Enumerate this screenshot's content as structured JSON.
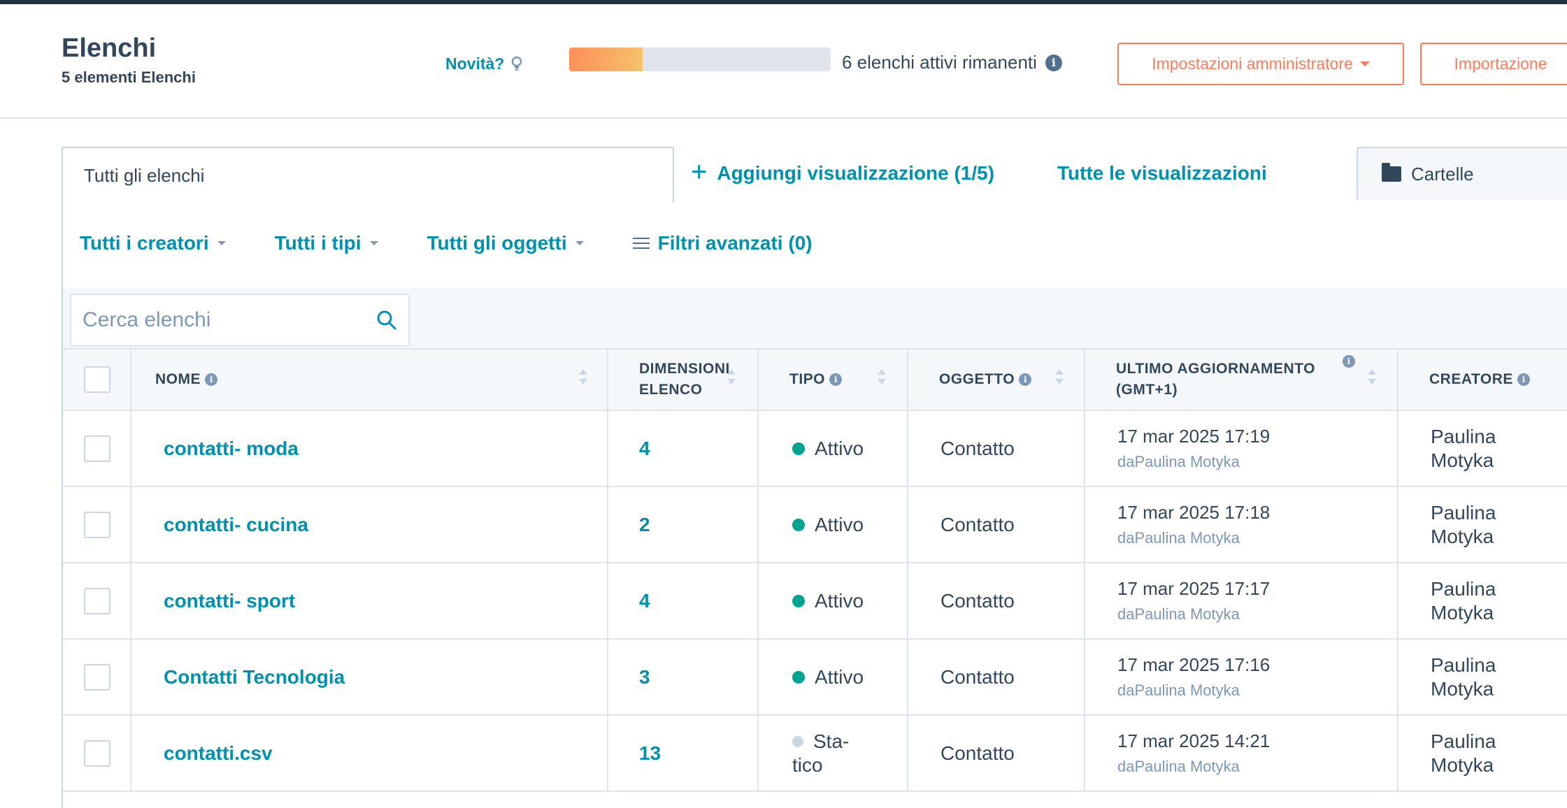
{
  "header": {
    "title": "Elenchi",
    "subtitle": "5 elementi Elenchi",
    "news_label": "Novità?",
    "usage_fraction": 0.28,
    "remaining_text": "6 elenchi attivi rimanenti",
    "admin_button": "Impostazioni amministratore",
    "import_button": "Importazione"
  },
  "tabs": {
    "active": "Tutti gli elenchi",
    "add_view": "Aggiungi visualizzazione (1/5)",
    "all_views": "Tutte le visualizzazioni",
    "folders": "Cartelle"
  },
  "filters": {
    "creators": "Tutti i creatori",
    "types": "Tutti i tipi",
    "objects": "Tutti gli oggetti",
    "advanced": "Filtri avanzati (0)"
  },
  "search": {
    "placeholder": "Cerca elenchi"
  },
  "columns": {
    "name": "NOME",
    "size": "DIMENSIONI ELENCO",
    "type": "TIPO",
    "object": "OGGETTO",
    "updated": "ULTIMO AGGIORNAMENTO (GMT+1)",
    "creator": "CREATORE"
  },
  "rows": [
    {
      "name": "contatti- moda",
      "size": "4",
      "type": "Attivo",
      "object": "Contatto",
      "updated": "17 mar 2025 17:19",
      "updated_by": "daPaulina Motyka",
      "creator_first": "Paulina",
      "creator_last": "Motyka"
    },
    {
      "name": "contatti- cucina",
      "size": "2",
      "type": "Attivo",
      "object": "Contatto",
      "updated": "17 mar 2025 17:18",
      "updated_by": "daPaulina Motyka",
      "creator_first": "Paulina",
      "creator_last": "Motyka"
    },
    {
      "name": "contatti- sport",
      "size": "4",
      "type": "Attivo",
      "object": "Contatto",
      "updated": "17 mar 2025 17:17",
      "updated_by": "daPaulina Motyka",
      "creator_first": "Paulina",
      "creator_last": "Motyka"
    },
    {
      "name": "Contatti Tecnologia",
      "size": "3",
      "type": "Attivo",
      "object": "Contatto",
      "updated": "17 mar 2025 17:16",
      "updated_by": "daPaulina Motyka",
      "creator_first": "Paulina",
      "creator_last": "Motyka"
    },
    {
      "name": "contatti.csv",
      "size": "13",
      "type_line1": "Sta-",
      "type_line2": "tico",
      "object": "Contatto",
      "updated": "17 mar 2025 14:21",
      "updated_by": "daPaulina Motyka",
      "creator_first": "Paulina",
      "creator_last": "Motyka"
    }
  ],
  "colors": {
    "accent": "#0091ae",
    "orange": "#ff7a59",
    "active_dot": "#00a38d",
    "static_dot": "#cbd6e2",
    "text": "#33475b"
  }
}
